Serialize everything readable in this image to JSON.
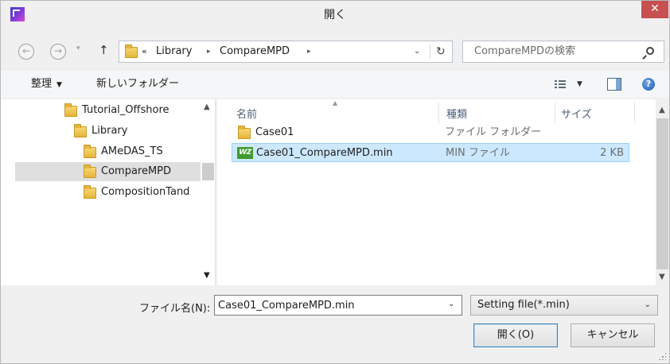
{
  "window": {
    "title": "開く",
    "close_label": "✕"
  },
  "nav": {
    "back_glyph": "←",
    "forward_glyph": "→",
    "history_glyph": "▾",
    "up_glyph": "↑",
    "breadcrumb": {
      "overflow": "«",
      "items": [
        "Library",
        "CompareMPD"
      ],
      "separator": "▸"
    },
    "dropdown_glyph": "⌄",
    "refresh_glyph": "↻",
    "search_placeholder": "CompareMPDの検索"
  },
  "toolbar": {
    "organize_label": "整理",
    "organize_caret": "▼",
    "new_folder_label": "新しいフォルダー",
    "view_caret": "▼",
    "help_glyph": "?"
  },
  "nav_pane": {
    "items": [
      {
        "label": "Tutorial_Offshore",
        "indent": 1
      },
      {
        "label": "Library",
        "indent": 2
      },
      {
        "label": "AMeDAS_TS",
        "indent": 3
      },
      {
        "label": "CompareMPD",
        "indent": 3,
        "selected": true
      },
      {
        "label": "CompositionTand",
        "indent": 3
      }
    ],
    "scroll_up": "▲",
    "scroll_down": "▼"
  },
  "file_list": {
    "columns": {
      "name": "名前",
      "type": "種類",
      "size": "サイズ"
    },
    "sort_glyph": "▲",
    "rows": [
      {
        "name": "Case01",
        "type": "ファイル フォルダー",
        "size": "",
        "icon": "folder-icon"
      },
      {
        "name": "Case01_CompareMPD.min",
        "type": "MIN ファイル",
        "size": "2 KB",
        "icon": "wz-file-icon",
        "icon_text": "WZ",
        "selected": true
      }
    ],
    "scroll_up": "▲",
    "scroll_down": "▼"
  },
  "bottom": {
    "filename_label": "ファイル名(N):",
    "filename_value": "Case01_CompareMPD.min",
    "filename_dd": "⌄",
    "filter_value": "Setting file(*.min)",
    "filter_dd": "⌄",
    "open_label": "開く(O)",
    "cancel_label": "キャンセル"
  },
  "colors": {
    "selection_bg": "#cce8ff",
    "selection_border": "#99d1ff",
    "close_bg": "#c75050",
    "header_text": "#4c607a"
  }
}
